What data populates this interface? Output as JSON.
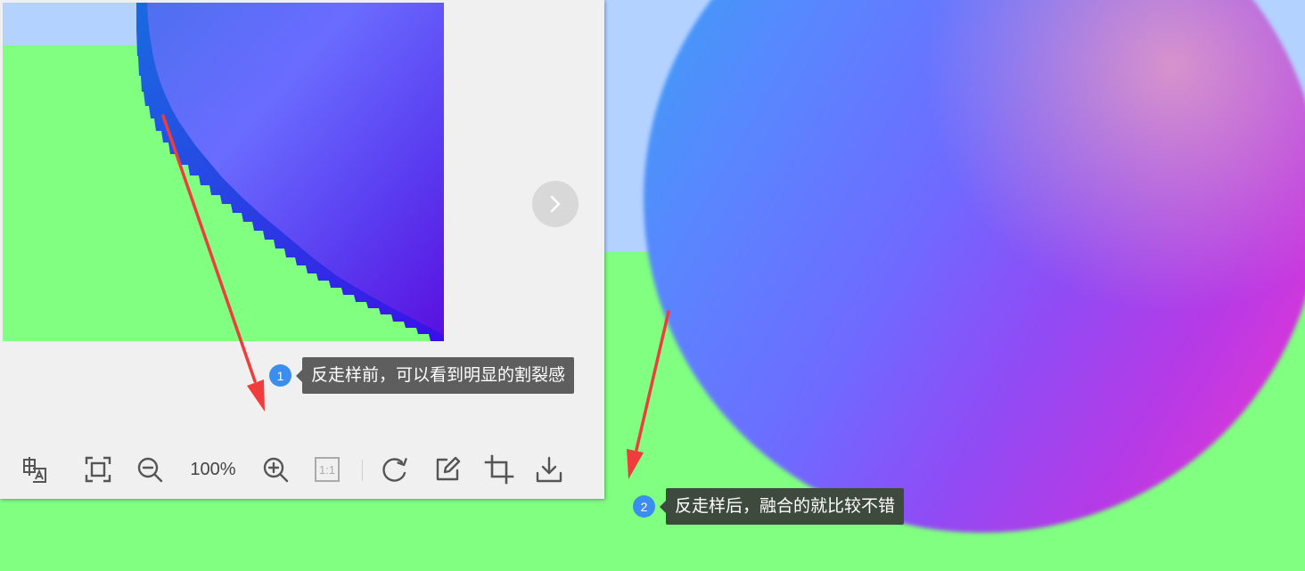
{
  "viewer": {
    "toolbar": {
      "zoom_level": "100%",
      "actual_size_label": "1:1"
    },
    "icons": {
      "translate": "translate-icon",
      "fit_screen": "fit-screen-icon",
      "zoom_out": "zoom-out-icon",
      "zoom_in": "zoom-in-icon",
      "actual_size": "actual-size-icon",
      "rotate": "rotate-icon",
      "edit": "edit-icon",
      "crop": "crop-icon",
      "download": "download-icon",
      "next": "chevron-right-icon"
    }
  },
  "annotations": [
    {
      "number": "1",
      "text": "反走样前，可以看到明显的割裂感"
    },
    {
      "number": "2",
      "text": "反走样后，融合的就比较不错"
    }
  ],
  "colors": {
    "arrow": "#f03c3c",
    "badge": "#3a8eed",
    "sky": "#b4d2ff",
    "ground": "#80ff80"
  }
}
